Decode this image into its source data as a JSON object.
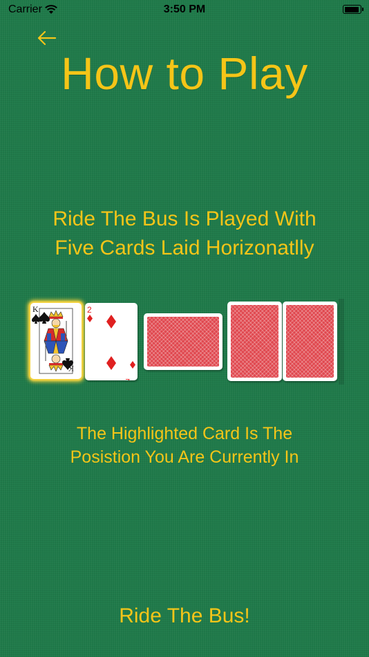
{
  "status_bar": {
    "carrier": "Carrier",
    "time": "3:50 PM"
  },
  "header": {
    "back_icon": "arrow-left-icon",
    "title": "How to Play"
  },
  "intro": {
    "line1": "Ride The Bus Is Played With",
    "line2": "Five Cards Laid Horizonatlly"
  },
  "cards": [
    {
      "rank": "K",
      "suit": "spades",
      "face_up": true,
      "highlighted": true
    },
    {
      "rank": "2",
      "suit": "diamonds",
      "face_up": true,
      "highlighted": false
    },
    {
      "face_up": false
    },
    {
      "face_up": false
    },
    {
      "face_up": false
    }
  ],
  "hint": {
    "line1": "The Highlighted Card Is The",
    "line2": "Posistion You Are Currently In"
  },
  "action": {
    "label": "Ride The Bus!"
  },
  "colors": {
    "felt": "#1f7a4a",
    "text": "#f5c518",
    "highlight": "#f7d23a",
    "card_back": "#e0484f",
    "diamond": "#e02020"
  }
}
